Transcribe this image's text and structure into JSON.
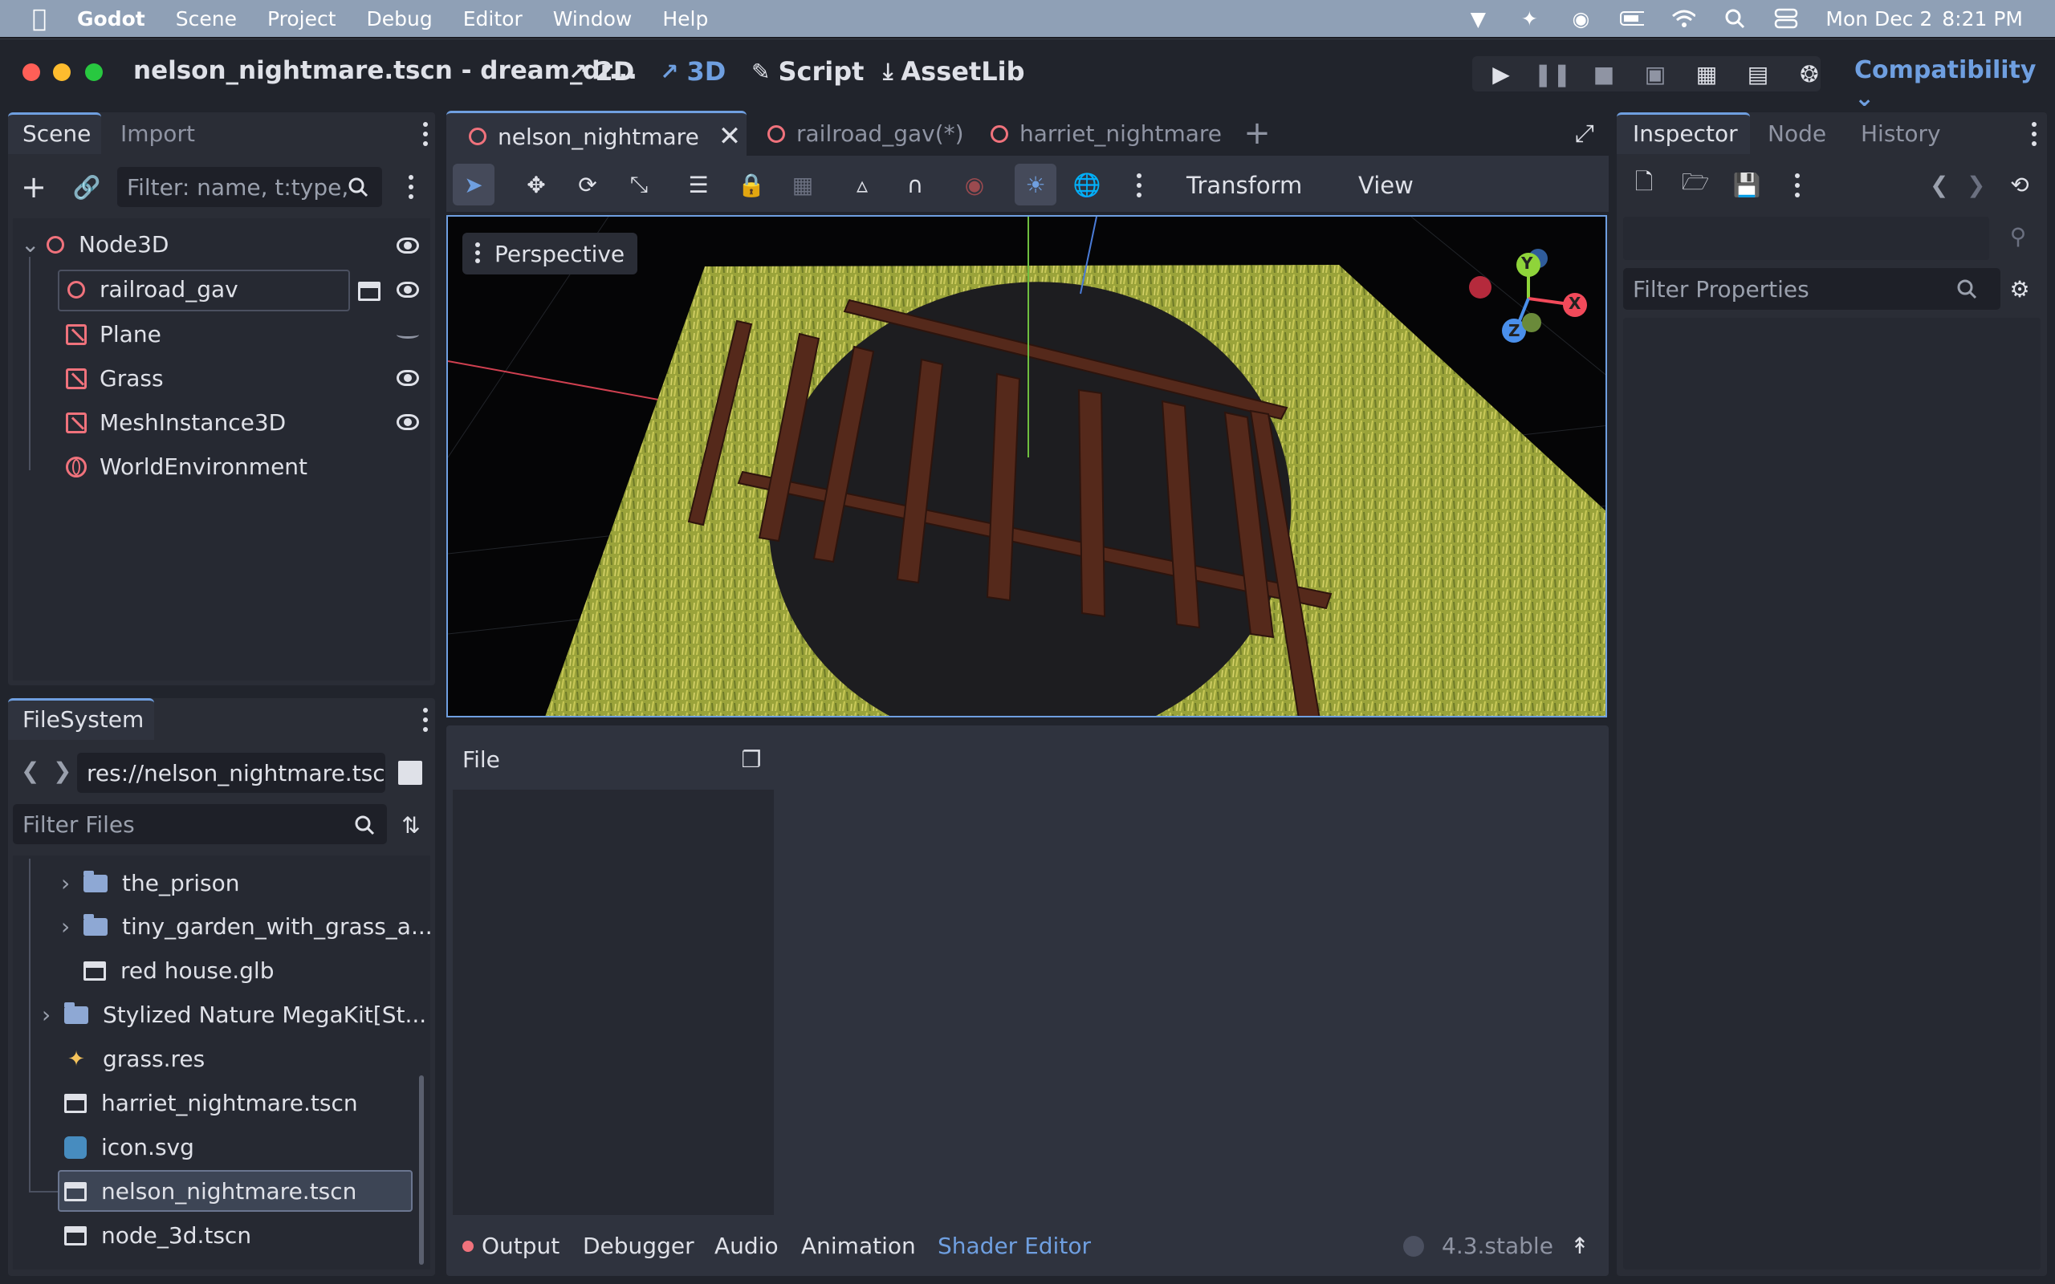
{
  "menubar": {
    "app": "Godot",
    "items": [
      "Scene",
      "Project",
      "Debug",
      "Editor",
      "Window",
      "Help"
    ],
    "date": "Mon Dec 2",
    "time": "8:21 PM"
  },
  "titlebar": {
    "title": "nelson_nightmare.tscn - dream_dr...",
    "modes": {
      "two_d": "2D",
      "three_d": "3D",
      "script": "Script",
      "assetlib": "AssetLib"
    },
    "renderer": "Compatibility"
  },
  "scene_dock": {
    "tabs": [
      "Scene",
      "Import"
    ],
    "filter_placeholder": "Filter: name, t:type,",
    "tree": [
      {
        "label": "Node3D"
      },
      {
        "label": "railroad_gav"
      },
      {
        "label": "Plane"
      },
      {
        "label": "Grass"
      },
      {
        "label": "MeshInstance3D"
      },
      {
        "label": "WorldEnvironment"
      }
    ]
  },
  "filesystem": {
    "tab": "FileSystem",
    "path": "res://nelson_nightmare.tsc",
    "filter_placeholder": "Filter Files",
    "items": [
      {
        "label": "the_prison"
      },
      {
        "label": "tiny_garden_with_grass_a..."
      },
      {
        "label": "red house.glb"
      },
      {
        "label": "Stylized Nature MegaKit[St..."
      },
      {
        "label": "grass.res"
      },
      {
        "label": "harriet_nightmare.tscn"
      },
      {
        "label": "icon.svg"
      },
      {
        "label": "nelson_nightmare.tscn"
      },
      {
        "label": "node_3d.tscn"
      }
    ]
  },
  "editor_tabs": [
    "nelson_nightmare",
    "railroad_gav(*)",
    "harriet_nightmare"
  ],
  "viewport": {
    "toolbar": {
      "transform": "Transform",
      "view": "View"
    },
    "perspective": "Perspective",
    "gizmo": {
      "x": "X",
      "y": "Y",
      "z": "Z"
    }
  },
  "bottom": {
    "file_label": "File",
    "tabs": [
      "Output",
      "Debugger",
      "Audio",
      "Animation",
      "Shader Editor"
    ],
    "version": "4.3.stable"
  },
  "inspector": {
    "tabs": [
      "Inspector",
      "Node",
      "History"
    ],
    "filter_placeholder": "Filter Properties"
  },
  "colors": {
    "accent": "#6f9fe0",
    "menubar": "#8fa0b6",
    "node_red": "#f0727c"
  }
}
